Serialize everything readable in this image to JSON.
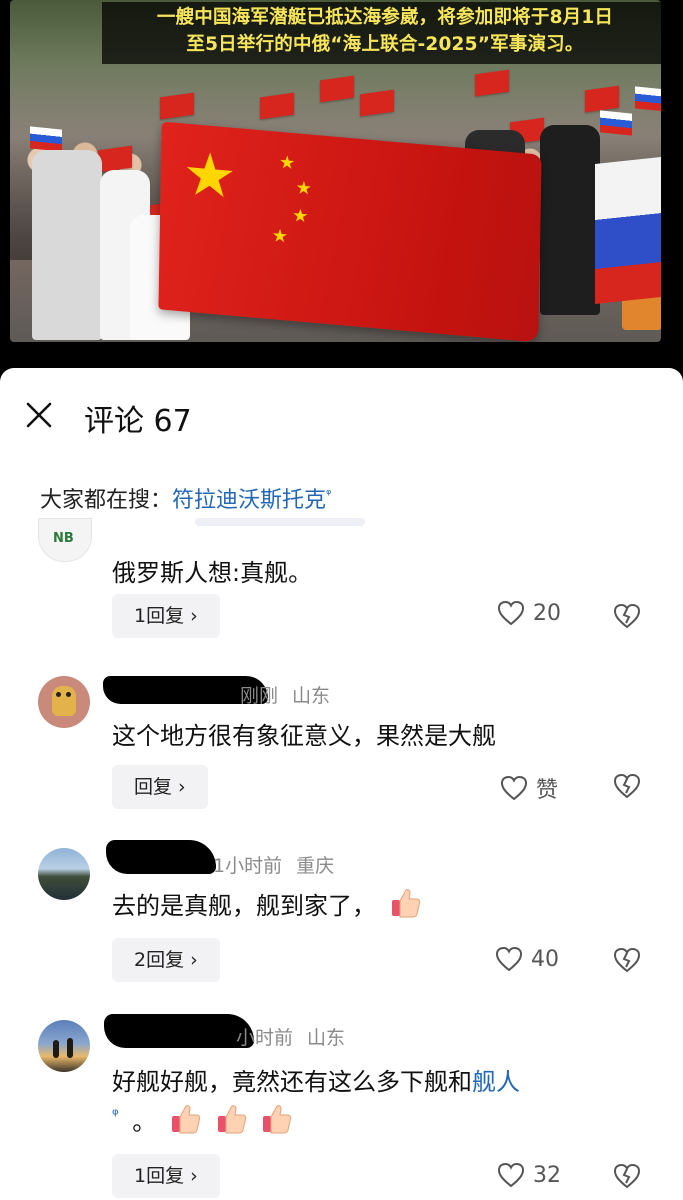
{
  "video": {
    "caption_line1": "一艘中国海军潜艇已抵达海参崴，将参加即将于8月1日",
    "caption_line2": "至5日举行的中俄“海上联合-2025”军事演习。"
  },
  "sheet": {
    "title": "评论 67",
    "hot_search_prefix": "大家都在搜：",
    "hot_search_link": "符拉迪沃斯托克",
    "search_mark": "ᵠ"
  },
  "comments": [
    {
      "avatar": "nb-logo-avatar",
      "avatar_text": "NB",
      "text": "俄罗斯人想:真舰。",
      "reply_label": "1回复 ›",
      "likes": "20"
    },
    {
      "avatar": "duck-avatar",
      "meta_time": "刚刚",
      "meta_loc": "山东",
      "text": "这个地方很有象征意义，果然是大舰",
      "reply_label": "回复 ›",
      "likes": "赞"
    },
    {
      "avatar": "lake-avatar",
      "meta_time": "1小时前",
      "meta_loc": "重庆",
      "text": "去的是真舰，舰到家了，",
      "reply_label": "2回复 ›",
      "likes": "40"
    },
    {
      "avatar": "sunset-avatar",
      "meta_time": "小时前",
      "meta_loc": "山东",
      "text": "好舰好舰，竟然还有这么多下舰和",
      "text_link": "舰人",
      "text_tail": "。",
      "reply_label": "1回复 ›",
      "likes": "32"
    }
  ],
  "colors": {
    "caption_text": "#f7e55a",
    "link_blue": "#2367b7",
    "flag_red": "#d7261d",
    "flag_star": "#ffd600"
  }
}
